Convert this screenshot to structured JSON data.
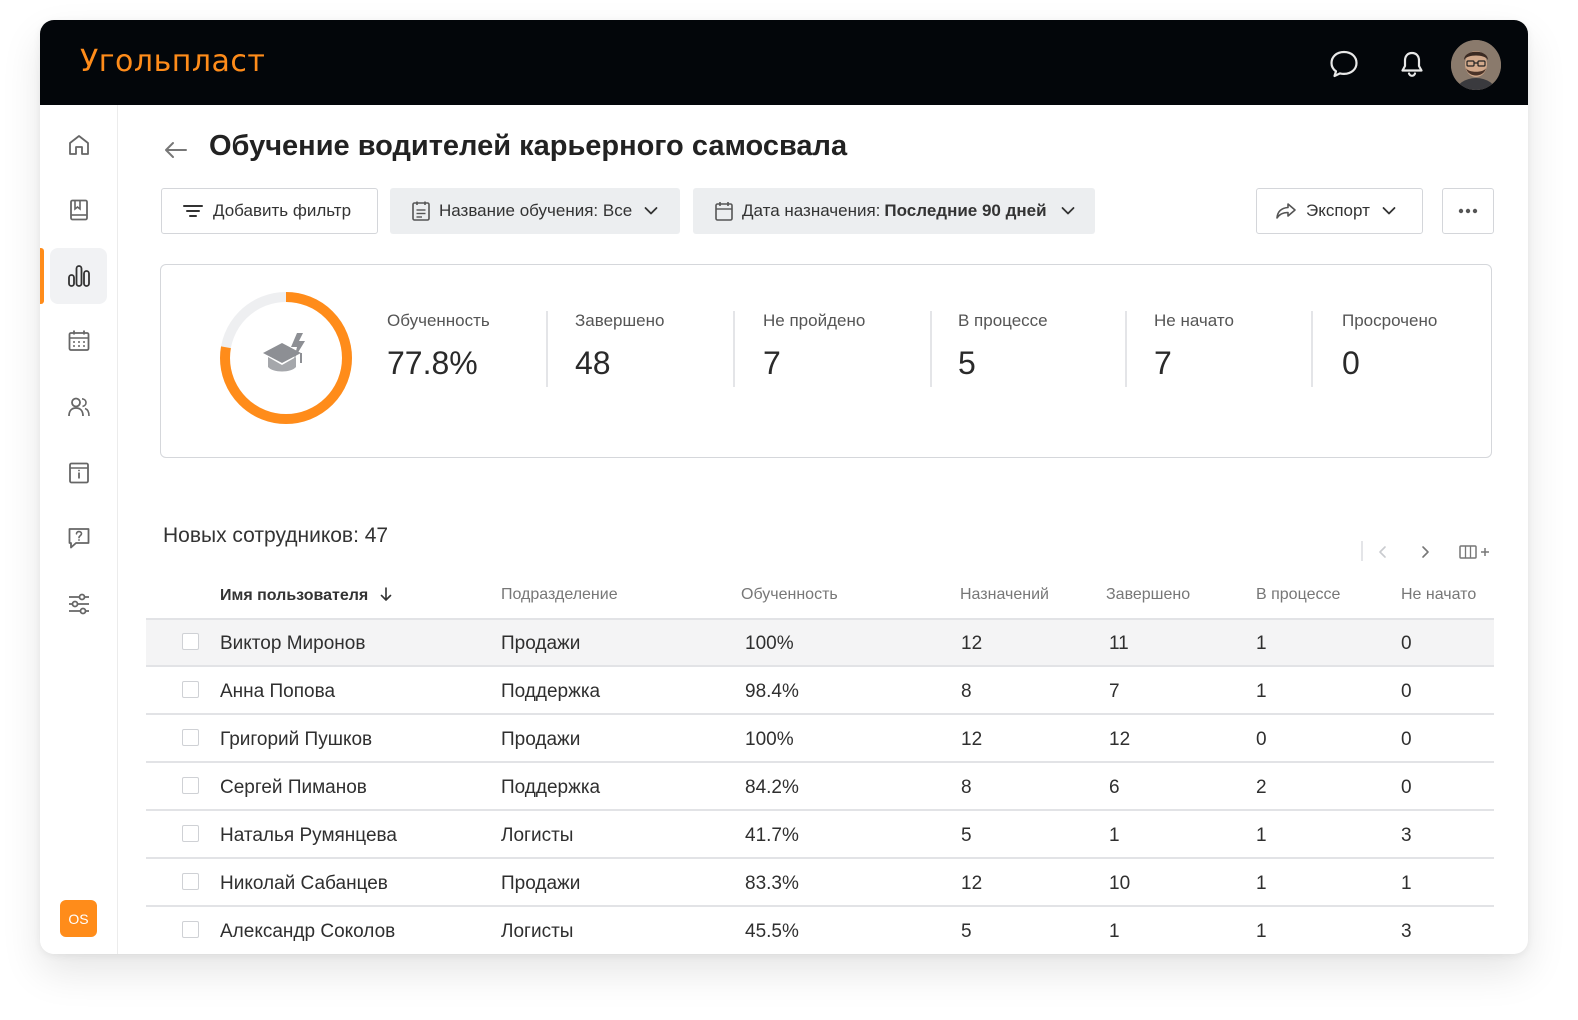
{
  "app": {
    "brand": "Угольпласт",
    "avatar_initials": "OS"
  },
  "sidebar": {
    "items": [
      {
        "name": "home",
        "icon": "home-icon"
      },
      {
        "name": "library",
        "icon": "book-icon"
      },
      {
        "name": "analytics",
        "icon": "bar-chart-icon",
        "active": true
      },
      {
        "name": "calendar",
        "icon": "calendar-icon"
      },
      {
        "name": "users",
        "icon": "users-icon"
      },
      {
        "name": "info",
        "icon": "info-board-icon"
      },
      {
        "name": "help",
        "icon": "help-chat-icon"
      },
      {
        "name": "settings",
        "icon": "sliders-icon"
      }
    ]
  },
  "page": {
    "title": "Обучение водителей карьерного самосвала"
  },
  "toolbar": {
    "add_filter": "Добавить фильтр",
    "training_filter_label": "Название обучения: Все",
    "date_filter_label": "Дата назначения: ",
    "date_filter_value": "Последние 90 дней",
    "export": "Экспорт"
  },
  "stats": {
    "progress_fraction": 0.778,
    "items": [
      {
        "label": "Обученность",
        "value": "77.8%"
      },
      {
        "label": "Завершено",
        "value": "48"
      },
      {
        "label": "Не пройдено",
        "value": "7"
      },
      {
        "label": "В процессе",
        "value": "5"
      },
      {
        "label": "Не начато",
        "value": "7"
      },
      {
        "label": "Просрочено",
        "value": "0"
      }
    ]
  },
  "table": {
    "count_label": "Новых сотрудников: 47",
    "columns": [
      "Имя пользователя",
      "Подразделение",
      "Обученность",
      "Назначений",
      "Завершено",
      "В процессе",
      "Не начато"
    ],
    "rows": [
      [
        "Виктор Миронов",
        "Продажи",
        "100%",
        "12",
        "11",
        "1",
        "0"
      ],
      [
        "Анна Попова",
        "Поддержка",
        "98.4%",
        "8",
        "7",
        "1",
        "0"
      ],
      [
        "Григорий Пушков",
        "Продажи",
        "100%",
        "12",
        "12",
        "0",
        "0"
      ],
      [
        "Сергей Пиманов",
        "Поддержка",
        "84.2%",
        "8",
        "6",
        "2",
        "0"
      ],
      [
        "Наталья Румянцева",
        "Логисты",
        "41.7%",
        "5",
        "1",
        "1",
        "3"
      ],
      [
        "Николай Сабанцев",
        "Продажи",
        "83.3%",
        "12",
        "10",
        "1",
        "1"
      ],
      [
        "Александр Соколов",
        "Логисты",
        "45.5%",
        "5",
        "1",
        "1",
        "3"
      ]
    ]
  },
  "colors": {
    "accent": "#ff8c1a",
    "topbar": "#03060a"
  }
}
